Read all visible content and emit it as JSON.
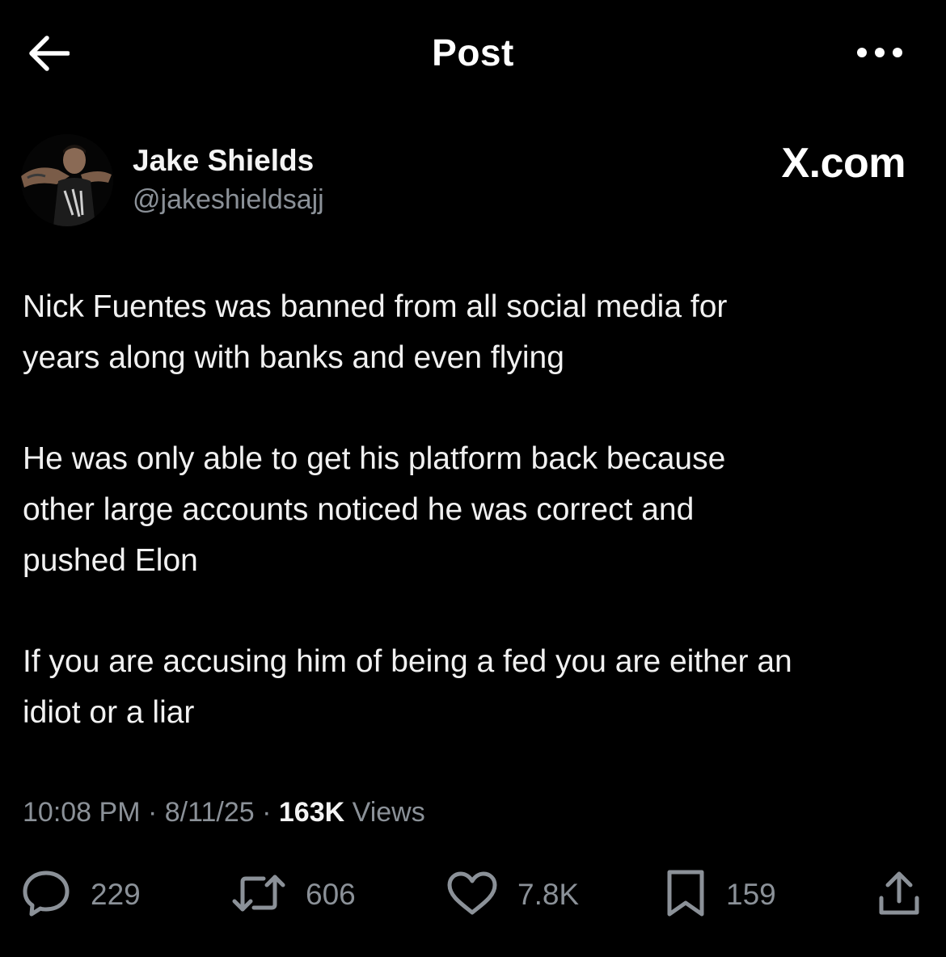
{
  "header": {
    "title": "Post",
    "back_icon": "arrow-left-icon",
    "more_icon": "more-horizontal-icon"
  },
  "author": {
    "display_name": "Jake Shields",
    "handle": "@jakeshieldsajj"
  },
  "brand": {
    "text": "X.com"
  },
  "post": {
    "paragraphs": [
      "Nick Fuentes was banned from all social media for\nyears along with banks and even flying",
      "He was only able to get his platform back because\nother large accounts noticed he was correct and\npushed Elon",
      "If you are accusing him of being a fed you are either an\nidiot or a liar"
    ]
  },
  "meta": {
    "time": "10:08 PM",
    "date": "8/11/25",
    "views_count": "163K",
    "views_label": "Views"
  },
  "actions": {
    "replies": "229",
    "reposts": "606",
    "likes": "7.8K",
    "bookmarks": "159"
  },
  "colors": {
    "background": "#000000",
    "text_primary": "#e7e9ea",
    "text_secondary": "#8b9198"
  }
}
